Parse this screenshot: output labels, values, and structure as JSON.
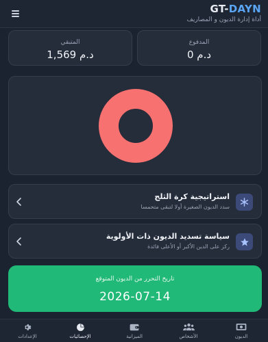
{
  "header": {
    "brand_part1": "GT-",
    "brand_part2": "DAYN",
    "subtitle": "أداة إدارة الديون و المصاريف",
    "menu_icon": "hamburger-icon"
  },
  "stats": {
    "remaining": {
      "label": "المتبقي",
      "value": "1,569 د.م"
    },
    "paid": {
      "label": "المدفوع",
      "value": "0 د.م"
    }
  },
  "chart_data": {
    "type": "pie",
    "variant": "doughnut",
    "values": [
      1
    ],
    "colors": [
      "#f6716f"
    ]
  },
  "strategies": [
    {
      "title": "استراتيجية كرة الثلج",
      "description": "سدد الديون الصغيرة أولا لتبقى متحمسا",
      "icon": "snowflake-icon"
    },
    {
      "title": "سياسة تسديد الديون ذات الأولوية",
      "description": "ركز على الدين الأكبر أو الأعلى فائدة",
      "icon": "star-icon"
    }
  ],
  "payoff": {
    "label": "تاريخ التحرر من الديون المتوقع",
    "date": "2026-07-14"
  },
  "nav": [
    {
      "label": "الإعدادات",
      "icon": "gear-icon"
    },
    {
      "label": "الإحصائيات",
      "icon": "pie-chart-icon"
    },
    {
      "label": "الميزانية",
      "icon": "wallet-icon"
    },
    {
      "label": "الأشخاص",
      "icon": "users-icon"
    },
    {
      "label": "الديون",
      "icon": "money-bill-icon"
    }
  ],
  "colors": {
    "background": "#1b2230",
    "card": "#252c3a",
    "accent_blue": "#5aa6f5",
    "success_green": "#21b977",
    "chart_red": "#f6716f"
  }
}
